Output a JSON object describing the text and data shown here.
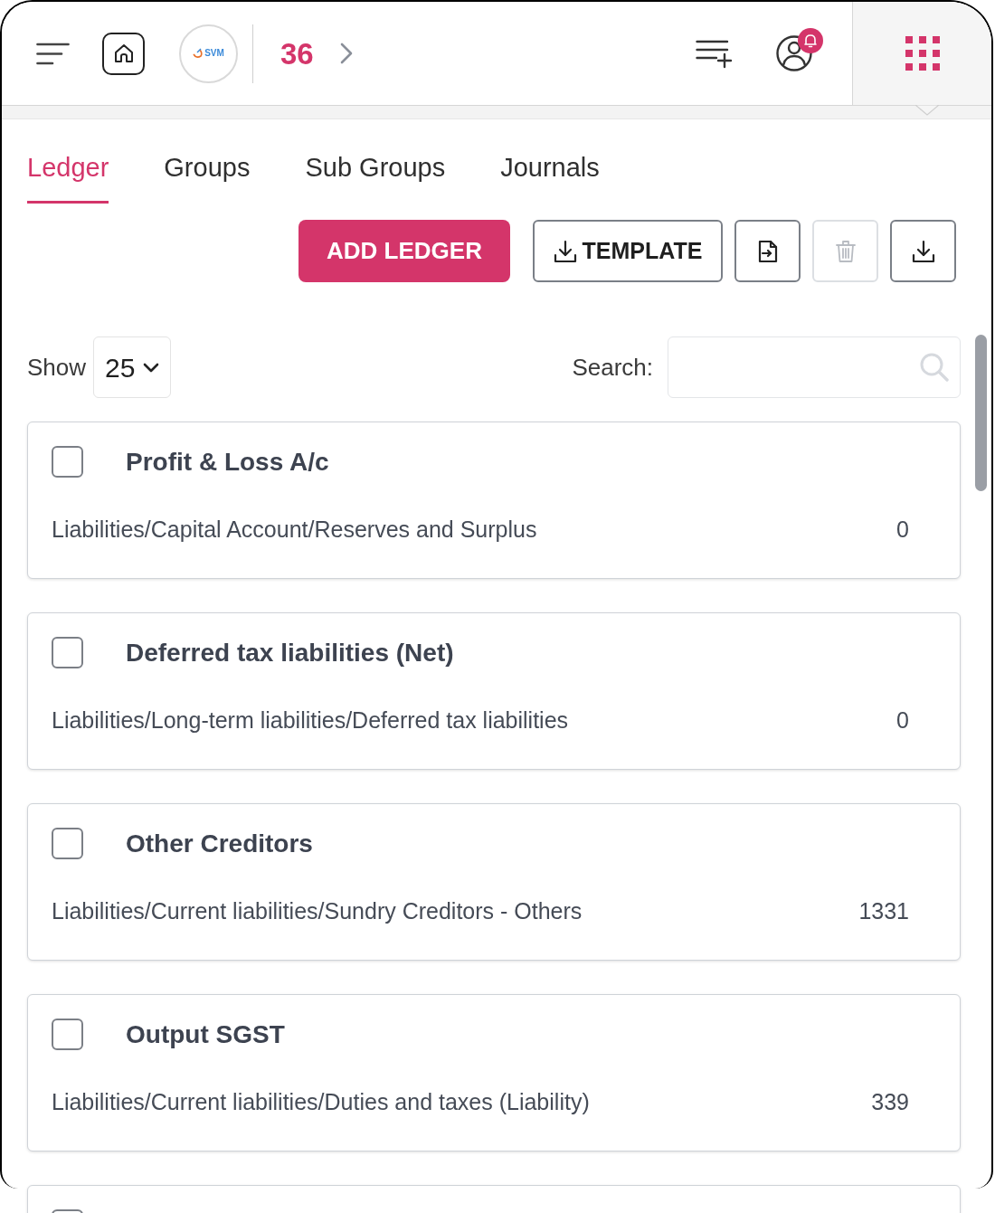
{
  "header": {
    "logo_text": "SVM",
    "breadcrumb": "36"
  },
  "tabs": [
    {
      "label": "Ledger",
      "selected": true
    },
    {
      "label": "Groups",
      "selected": false
    },
    {
      "label": "Sub Groups",
      "selected": false
    },
    {
      "label": "Journals",
      "selected": false
    }
  ],
  "toolbar": [
    {
      "kind": "primary",
      "label": "ADD LEDGER",
      "disabled": false
    },
    {
      "kind": "outline",
      "label": "TEMPLATE",
      "disabled": false
    },
    {
      "kind": "icon",
      "disabled": false
    },
    {
      "kind": "icon",
      "disabled": true
    },
    {
      "kind": "icon",
      "disabled": false
    }
  ],
  "show": {
    "label": "Show",
    "value": "25"
  },
  "search": {
    "label": "Search:"
  },
  "ledgers": [
    {
      "checked": false,
      "title": "Profit & Loss A/c",
      "path": "Liabilities/Capital Account/Reserves and Surplus",
      "count": "0"
    },
    {
      "checked": false,
      "title": "Deferred tax liabilities (Net)",
      "path": "Liabilities/Long-term liabilities/Deferred tax liabilities",
      "count": "0"
    },
    {
      "checked": false,
      "title": "Other Creditors",
      "path": "Liabilities/Current liabilities/Sundry Creditors - Others",
      "count": "1331"
    },
    {
      "checked": false,
      "title": "Output SGST",
      "path": "Liabilities/Current liabilities/Duties and taxes (Liability)",
      "count": "339"
    },
    {
      "checked": false
    }
  ]
}
